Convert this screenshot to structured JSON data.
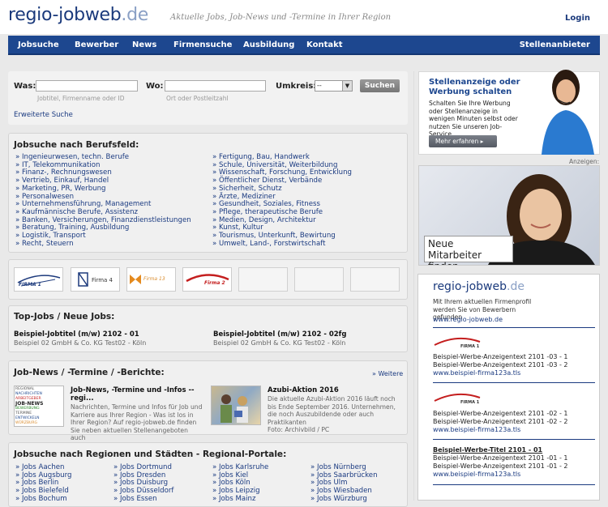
{
  "header": {
    "logo_main": "regio-jobweb",
    "logo_tld": ".de",
    "tagline": "Aktuelle Jobs, Job-News und -Termine in Ihrer Region",
    "login": "Login"
  },
  "nav": {
    "items": [
      "Jobsuche",
      "Bewerber",
      "News",
      "Firmensuche",
      "Ausbildung",
      "Kontakt"
    ],
    "right": "Stellenanbieter"
  },
  "search": {
    "was_label": "Was:",
    "was_hint": "Jobtitel, Firmenname oder ID",
    "wo_label": "Wo:",
    "wo_hint": "Ort oder Postleitzahl",
    "umkreis_label": "Umkreis:",
    "umkreis_value": "--",
    "submit": "Suchen",
    "advanced": "Erweiterte Suche"
  },
  "berufsfeld": {
    "title": "Jobsuche nach Berufsfeld:",
    "col1": [
      "» Ingenieurwesen, techn. Berufe",
      "» IT, Telekommunikation",
      "» Finanz-, Rechnungswesen",
      "» Vertrieb, Einkauf, Handel",
      "» Marketing, PR, Werbung",
      "» Personalwesen",
      "» Unternehmensführung, Management",
      "» Kaufmännische Berufe, Assistenz",
      "» Banken, Versicherungen, Finanzdienstleistungen",
      "» Beratung, Training, Ausbildung",
      "» Logistik, Transport",
      "» Recht, Steuern"
    ],
    "col2": [
      "» Fertigung, Bau, Handwerk",
      "» Schule, Universität, Weiterbildung",
      "» Wissenschaft, Forschung, Entwicklung",
      "» Öffentlicher Dienst, Verbände",
      "» Sicherheit, Schutz",
      "» Ärzte, Mediziner",
      "» Gesundheit, Soziales, Fitness",
      "» Pflege, therapeutische Berufe",
      "» Medien, Design, Architektur",
      "» Kunst, Kultur",
      "» Tourismus, Unterkunft, Bewirtung",
      "» Umwelt, Land-, Forstwirtschaft"
    ]
  },
  "firm_logos": [
    "FIRMA 1",
    "Firma 4",
    "Firma 13",
    "Firma 2"
  ],
  "topjobs": {
    "title": "Top-Jobs / Neue Jobs:",
    "jobs": [
      {
        "title": "Beispiel-Jobtitel (m/w) 2102 - 01",
        "company": "Beispiel 02 GmbH & Co. KG Test02 - Köln"
      },
      {
        "title": "Beispiel-Jobtitel (m/w) 2102 - 02fg",
        "company": "Beispiel 02 GmbH & Co. KG Test02 - Köln"
      }
    ]
  },
  "news": {
    "title": "Job-News / -Termine / -Berichte:",
    "more": "» Weitere",
    "items": [
      {
        "title": "Job-News, -Termine und -Infos -- regi...",
        "text": "Nachrichten, Termine und Infos für Job und Karriere aus Ihrer Region - Was ist los in Ihrer Region? Auf regio-jobweb.de finden Sie neben aktuellen Stellenangeboten auch",
        "img_words": [
          "REGIONAL",
          "NACHRICHTEN",
          "ARBEITGEBER",
          "JOB-NEWS",
          "BEWERBUNG",
          "TERMINE",
          "ENTWICKELN",
          "WÜRZBURG"
        ]
      },
      {
        "title": "Azubi-Aktion 2016",
        "text": "Die aktuelle Azubi-Aktion 2016 läuft noch bis Ende September 2016. Unternehmen, die noch Auszubildende oder auch Praktikanten",
        "caption": "Foto: Archivbild / PC"
      }
    ]
  },
  "regions": {
    "title": "Jobsuche nach Regionen und Städten - Regional-Portale:",
    "col1": [
      "» Jobs Aachen",
      "» Jobs Augsburg",
      "» Jobs Berlin",
      "» Jobs Bielefeld",
      "» Jobs Bochum"
    ],
    "col2": [
      "» Jobs Dortmund",
      "» Jobs Dresden",
      "» Jobs Duisburg",
      "» Jobs Düsseldorf",
      "» Jobs Essen"
    ],
    "col3": [
      "» Jobs Karlsruhe",
      "» Jobs Kiel",
      "» Jobs Köln",
      "» Jobs Leipzig",
      "» Jobs Mainz"
    ],
    "col4": [
      "» Jobs Nürnberg",
      "» Jobs Saarbrücken",
      "» Jobs Ulm",
      "» Jobs Wiesbaden",
      "» Jobs Würzburg"
    ]
  },
  "promo": {
    "title1": "Stellenanzeige oder",
    "title2": "Werbung schalten",
    "text": "Schalten Sie Ihre Werbung oder Stellenanzeige in wenigen Minuten selbst oder nutzen Sie unseren Job-Service.",
    "button": "Mehr erfahren ▸"
  },
  "ads_label": "Anzeigen:",
  "banner": {
    "line1": "Neue Mitarbeiter",
    "line2": "finden"
  },
  "sidead": {
    "logo_main": "regio-jobweb",
    "logo_tld": ".de",
    "text": "Mit Ihrem aktuellen Firmenprofil werden Sie von Bewerbern gefunden",
    "url": "www.regio-jobweb.de",
    "blocks": [
      {
        "logo": "FIRMA 1",
        "title": "",
        "l1": "Beispiel-Werbe-Anzeigentext 2101 -03 - 1",
        "l2": "Beispiel-Werbe-Anzeigentext 2101 -03 - 2",
        "url": "www.beispiel-firma123a.tls"
      },
      {
        "logo": "FIRMA 1",
        "title": "",
        "l1": "Beispiel-Werbe-Anzeigentext 2101 -02 - 1",
        "l2": "Beispiel-Werbe-Anzeigentext 2101 -02 - 2",
        "url": "www.beispiel-firma123a.tls"
      },
      {
        "logo": "",
        "title": "Beispiel-Werbe-Titel 2101 - 01",
        "l1": "Beispiel-Werbe-Anzeigentext 2101 -01 - 1",
        "l2": "Beispiel-Werbe-Anzeigentext 2101 -01 - 2",
        "url": "www.beispiel-firma123a.tls"
      }
    ]
  }
}
